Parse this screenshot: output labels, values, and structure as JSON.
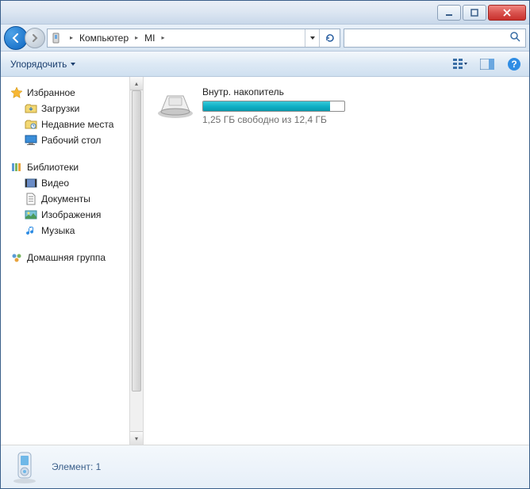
{
  "titlebar": {
    "minimize": "min",
    "maximize": "max",
    "close": "close"
  },
  "breadcrumb": {
    "root_icon": "device",
    "segments": [
      "Компьютер",
      "MI"
    ]
  },
  "search": {
    "placeholder": ""
  },
  "toolbar": {
    "organize_label": "Упорядочить",
    "view_icon": "view-options",
    "preview_icon": "preview-pane",
    "help_icon": "help"
  },
  "sidebar": {
    "favorites": {
      "label": "Избранное",
      "items": [
        {
          "icon": "downloads",
          "label": "Загрузки"
        },
        {
          "icon": "recent",
          "label": "Недавние места"
        },
        {
          "icon": "desktop",
          "label": "Рабочий стол"
        }
      ]
    },
    "libraries": {
      "label": "Библиотеки",
      "items": [
        {
          "icon": "video",
          "label": "Видео"
        },
        {
          "icon": "documents",
          "label": "Документы"
        },
        {
          "icon": "pictures",
          "label": "Изображения"
        },
        {
          "icon": "music",
          "label": "Музыка"
        }
      ]
    },
    "homegroup": {
      "label": "Домашняя группа"
    }
  },
  "content": {
    "storage": {
      "name": "Внутр. накопитель",
      "fill_percent": 90,
      "subtext": "1,25 ГБ свободно из 12,4 ГБ"
    }
  },
  "details": {
    "text": "Элемент: 1"
  }
}
